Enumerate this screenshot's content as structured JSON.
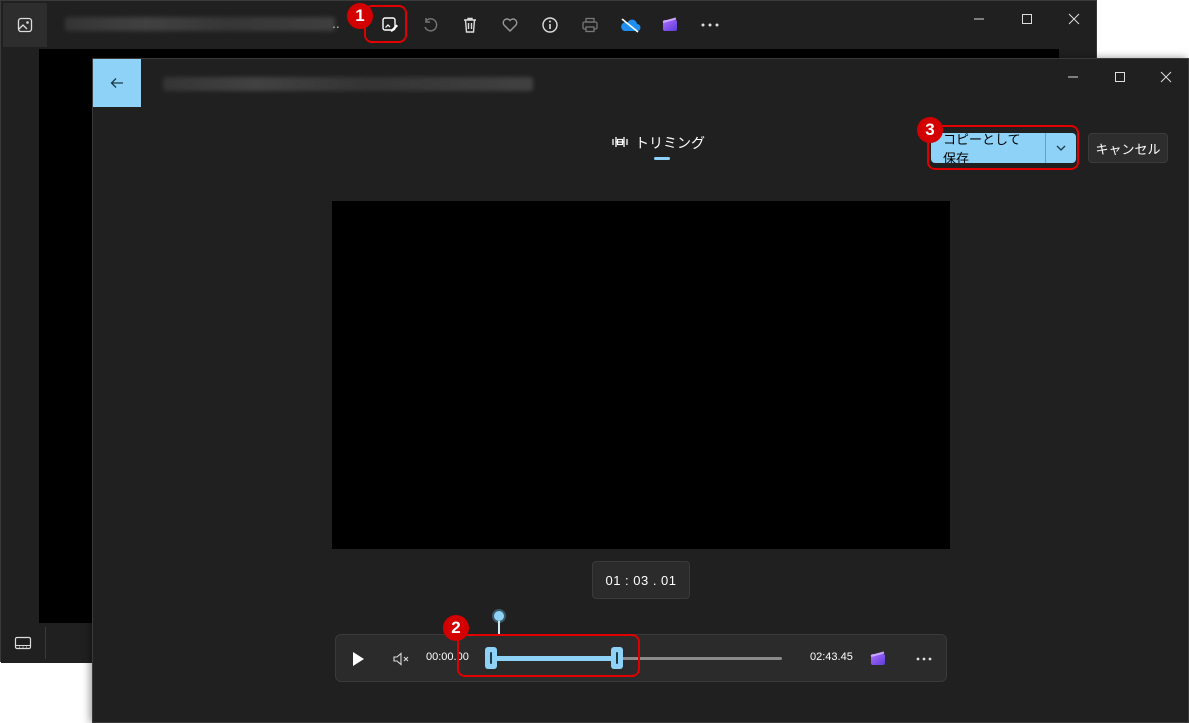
{
  "back_window": {
    "toolbar_icons": [
      "edit-image-icon",
      "rotate-icon",
      "delete-icon",
      "favorite-icon",
      "info-icon",
      "print-icon",
      "onedrive-icon",
      "clipchamp-icon",
      "more-icon"
    ],
    "title_ellipsis": ".."
  },
  "front_window": {
    "tab_label": "トリミング",
    "save_button_label": "コピーとして保存",
    "cancel_button_label": "キャンセル",
    "timecode": "01 : 03 . 01",
    "player": {
      "start_time": "00:00.00",
      "end_time": "02:43.45",
      "selection_start_fraction": 0.08,
      "selection_end_fraction": 0.48,
      "playhead_fraction": 0.11
    }
  },
  "annotations": {
    "badge_1": "1",
    "badge_2": "2",
    "badge_3": "3"
  },
  "colors": {
    "accent": "#8ed3f7",
    "highlight": "#e00000",
    "window_bg": "#202020"
  }
}
